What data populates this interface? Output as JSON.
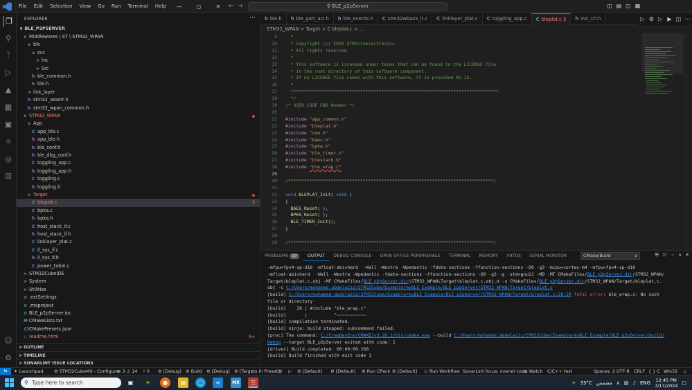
{
  "titlebar": {
    "menu": [
      "File",
      "Edit",
      "Selection",
      "View",
      "Go",
      "Run",
      "Terminal",
      "Help"
    ],
    "search": "BLE_p2pServer"
  },
  "sidebar": {
    "header": "EXPLORER",
    "project": "BLE_P2PSERVER",
    "tree": [
      {
        "depth": 1,
        "chev": "v",
        "label": "Middlewares \\ ST \\ STM32_WPAN",
        "type": "folder"
      },
      {
        "depth": 2,
        "chev": "v",
        "label": "ble",
        "type": "folder"
      },
      {
        "depth": 3,
        "chev": "v",
        "label": "svc",
        "type": "folder"
      },
      {
        "depth": 4,
        "chev": ">",
        "label": "Inc",
        "type": "folder"
      },
      {
        "depth": 4,
        "chev": ">",
        "label": "Src",
        "type": "folder"
      },
      {
        "depth": 3,
        "label": "ble_common.h",
        "type": "h"
      },
      {
        "depth": 3,
        "label": "ble.h",
        "type": "h"
      },
      {
        "depth": 2,
        "chev": ">",
        "label": "link_layer",
        "type": "folder"
      },
      {
        "depth": 2,
        "label": "stm32_assert.h",
        "type": "h"
      },
      {
        "depth": 2,
        "label": "stm32_wpan_common.h",
        "type": "h"
      },
      {
        "depth": 1,
        "chev": "v",
        "label": "STM32_WPAN",
        "type": "folder",
        "red": true,
        "dot": true
      },
      {
        "depth": 2,
        "chev": "v",
        "label": "App",
        "type": "folder"
      },
      {
        "depth": 3,
        "label": "app_ble.c",
        "type": "c"
      },
      {
        "depth": 3,
        "label": "app_ble.h",
        "type": "h"
      },
      {
        "depth": 3,
        "label": "ble_conf.h",
        "type": "h"
      },
      {
        "depth": 3,
        "label": "ble_dbg_conf.h",
        "type": "h"
      },
      {
        "depth": 3,
        "label": "toggling_app.c",
        "type": "c"
      },
      {
        "depth": 3,
        "label": "toggling_app.h",
        "type": "h"
      },
      {
        "depth": 3,
        "label": "toggling.c",
        "type": "c"
      },
      {
        "depth": 3,
        "label": "toggling.h",
        "type": "h"
      },
      {
        "depth": 2,
        "chev": "v",
        "label": "Target",
        "type": "folder",
        "red": true,
        "dot": true
      },
      {
        "depth": 3,
        "label": "bleplat.c",
        "type": "c",
        "red": true,
        "badge": "3",
        "selected": true
      },
      {
        "depth": 3,
        "label": "bpka.c",
        "type": "c"
      },
      {
        "depth": 3,
        "label": "bpka.h",
        "type": "h"
      },
      {
        "depth": 3,
        "label": "host_stack_if.c",
        "type": "c"
      },
      {
        "depth": 3,
        "label": "host_stack_if.h",
        "type": "h"
      },
      {
        "depth": 3,
        "label": "linklayer_plat.c",
        "type": "c"
      },
      {
        "depth": 3,
        "label": "ll_sys_if.c",
        "type": "c"
      },
      {
        "depth": 3,
        "label": "ll_sys_if.h",
        "type": "h"
      },
      {
        "depth": 3,
        "label": "power_table.c",
        "type": "c"
      },
      {
        "depth": 1,
        "chev": ">",
        "label": "STM32CubeIDE",
        "type": "folder"
      },
      {
        "depth": 1,
        "chev": ">",
        "label": "System",
        "type": "folder"
      },
      {
        "depth": 1,
        "chev": ">",
        "label": "Utilities",
        "type": "folder"
      },
      {
        "depth": 1,
        "label": ".extSettings",
        "type": "cfg"
      },
      {
        "depth": 1,
        "label": ".mxproject",
        "type": "cfg"
      },
      {
        "depth": 1,
        "label": "BLE_p2pServer.ioc",
        "type": "ioc"
      },
      {
        "depth": 1,
        "label": "CMakeLists.txt",
        "type": "cm"
      },
      {
        "depth": 1,
        "label": "CMakePresets.json",
        "type": "json"
      },
      {
        "depth": 1,
        "label": "readme.html",
        "type": "html",
        "red": true,
        "badge": "9+"
      }
    ],
    "sections": [
      "OUTLINE",
      "TIMELINE",
      "SONARLINT ISSUE LOCATIONS"
    ]
  },
  "tabs": [
    {
      "label": "ble.h",
      "icon": "h"
    },
    {
      "label": "ble_gatt_aci.h",
      "icon": "h"
    },
    {
      "label": "ble_events.h",
      "icon": "h"
    },
    {
      "label": "stm32wbaxx_it.c",
      "icon": "c"
    },
    {
      "label": "linklayer_plat.c",
      "icon": "c"
    },
    {
      "label": "toggling_app.c",
      "icon": "c"
    },
    {
      "label": "bleplat.c 3",
      "icon": "c",
      "active": true
    },
    {
      "label": "svc_ctl.h",
      "icon": "h"
    }
  ],
  "breadcrumb": "STM32_WPAN  >  Target  >  C  bleplat.c  >  ...",
  "editor": {
    "lines": [
      {
        "n": "9",
        "segs": [
          [
            "c-com",
            "  *"
          ]
        ]
      },
      {
        "n": "10",
        "segs": [
          [
            "c-com",
            "  * Copyright (c) 2024 STMicroelectronics."
          ]
        ]
      },
      {
        "n": "11",
        "segs": [
          [
            "c-com",
            "  * All rights reserved."
          ]
        ]
      },
      {
        "n": "12",
        "segs": [
          [
            "c-com",
            "  *"
          ]
        ]
      },
      {
        "n": "13",
        "segs": [
          [
            "c-com",
            "  * This software is licensed under terms that can be found in the LICENSE file"
          ]
        ]
      },
      {
        "n": "14",
        "segs": [
          [
            "c-com",
            "  * in the root directory of this software component."
          ]
        ]
      },
      {
        "n": "15",
        "segs": [
          [
            "c-com",
            "  * If no LICENSE file comes with this software, it is provided AS-IS."
          ]
        ]
      },
      {
        "n": "16",
        "segs": [
          [
            "c-com",
            "  *"
          ]
        ]
      },
      {
        "n": "17",
        "segs": [
          [
            "c-com",
            "  ******************************************************************************"
          ]
        ]
      },
      {
        "n": "18",
        "segs": [
          [
            "c-com",
            "  */"
          ]
        ]
      },
      {
        "n": "19",
        "segs": [
          [
            "c-com",
            "/* USER CODE END Header */"
          ]
        ]
      },
      {
        "n": "20",
        "segs": []
      },
      {
        "n": "21",
        "segs": [
          [
            "c-kw",
            "#include "
          ],
          [
            "c-str",
            "\"app_common.h\""
          ]
        ]
      },
      {
        "n": "22",
        "segs": [
          [
            "c-kw",
            "#include "
          ],
          [
            "c-str",
            "\"bleplat.h\""
          ]
        ]
      },
      {
        "n": "23",
        "segs": [
          [
            "c-kw",
            "#include "
          ],
          [
            "c-str",
            "\"nvm.h\""
          ]
        ]
      },
      {
        "n": "24",
        "segs": [
          [
            "c-kw",
            "#include "
          ],
          [
            "c-str",
            "\"baes.h\""
          ]
        ]
      },
      {
        "n": "25",
        "segs": [
          [
            "c-kw",
            "#include "
          ],
          [
            "c-str",
            "\"bpka.h\""
          ]
        ]
      },
      {
        "n": "26",
        "segs": [
          [
            "c-kw",
            "#include "
          ],
          [
            "c-str",
            "\"ble_timer.h\""
          ]
        ]
      },
      {
        "n": "27",
        "segs": [
          [
            "c-kw",
            "#include "
          ],
          [
            "c-str",
            "\"blestack.h\""
          ]
        ]
      },
      {
        "n": "28",
        "segs": [
          [
            "c-kw",
            "#include "
          ],
          [
            "c-str squig",
            "\"ble_wrap.c\""
          ]
        ]
      },
      {
        "n": "29",
        "segs": [],
        "cur": true
      },
      {
        "n": "30",
        "segs": [
          [
            "c-com",
            "/*****************************************************************************/"
          ]
        ]
      },
      {
        "n": "31",
        "segs": []
      },
      {
        "n": "32",
        "segs": [
          [
            "c-ty",
            "void "
          ],
          [
            "c-fn",
            "BLEPLAT_Init"
          ],
          [
            "",
            "( "
          ],
          [
            "c-ty",
            "void"
          ],
          [
            "",
            " )"
          ]
        ]
      },
      {
        "n": "33",
        "segs": [
          [
            "",
            "{"
          ]
        ]
      },
      {
        "n": "34",
        "segs": [
          [
            "",
            "  "
          ],
          [
            "c-fn",
            "BAES_Reset"
          ],
          [
            "",
            "( );"
          ]
        ]
      },
      {
        "n": "35",
        "segs": [
          [
            "",
            "  "
          ],
          [
            "c-fn",
            "BPKA_Reset"
          ],
          [
            "",
            "( );"
          ]
        ]
      },
      {
        "n": "36",
        "segs": [
          [
            "",
            "  "
          ],
          [
            "c-fn",
            "BLE_TIMER_Init"
          ],
          [
            "",
            "();"
          ]
        ]
      },
      {
        "n": "37",
        "segs": [
          [
            "",
            "}"
          ]
        ]
      },
      {
        "n": "38",
        "segs": []
      },
      {
        "n": "39",
        "segs": [
          [
            "c-com",
            "/*****************************************************************************/"
          ]
        ]
      }
    ]
  },
  "panel": {
    "tabs": [
      {
        "label": "PROBLEMS",
        "count": "17"
      },
      {
        "label": "OUTPUT",
        "active": true
      },
      {
        "label": "DEBUG CONSOLE"
      },
      {
        "label": "OPEN OFFICE PERIPHERALS"
      },
      {
        "label": "TERMINAL"
      },
      {
        "label": "MEMORY"
      },
      {
        "label": "XRTOS"
      },
      {
        "label": "SERIAL MONITOR"
      }
    ],
    "channel": "CMake/Build",
    "output": [
      [
        [
          "",
          "-mfpu=fpv4-sp-d16 -mfloat-abi=hard  -Wall -Wextra -Wpedantic -fdata-sections -ffunction-sections -O0 -g3 -mcpu=cortex-m4 -mfpu=fpv4-sp-d16"
        ]
      ],
      [
        [
          "",
          "-mfloat-abi=hard  -Wall -Wextra -Wpedantic -fdata-sections -ffunction-sections -O0 -g3 -g -std=gnu11 -MD -MT CMakeFiles/"
        ],
        [
          "olink",
          "BLE_p2pServer.dir"
        ],
        [
          "",
          "/STM32_WPAN/"
        ]
      ],
      [
        [
          "",
          "Target/bleplat.c.obj -MF CMakeFiles/"
        ],
        [
          "olink",
          "BLE_p2pServer.dir"
        ],
        [
          "",
          "\\STM32_WPAN\\Target\\bleplat.c.obj.d -o CMakeFiles/"
        ],
        [
          "olink",
          "BLE_p2pServer.dir"
        ],
        [
          "",
          "/STM32_WPAN/Target/bleplat.c."
        ]
      ],
      [
        [
          "",
          "obj -c "
        ],
        [
          "olink",
          "C:/Users/mohamed.abdelaziz/STM32Cube/Example/myBLE_Example/BLE_p2pServer/STM32_WPAN/Target/bleplat.c"
        ]
      ],
      [
        [
          "",
          "[build] "
        ],
        [
          "olink",
          "C:/Users/mohamed.abdelaziz/STM32Cube/Example/myBLE_Example/BLE_p2pServer/STM32_WPAN/Target/bleplat.c:28:10"
        ],
        [
          ":",
          " "
        ],
        [
          "oerr",
          "fatal error"
        ],
        [
          "",
          ": ble_wrap.c: No such"
        ]
      ],
      [
        [
          "",
          "file or directory"
        ]
      ],
      [
        [
          "",
          "[build]    28 | #include \"ble_wrap.c\""
        ]
      ],
      [
        [
          "",
          "[build]       |          ^~~~~~~~~~~~"
        ]
      ],
      [
        [
          "",
          "[build] compilation terminated."
        ]
      ],
      [
        [
          "",
          "[build] ninja: build stopped: subcommand failed."
        ]
      ],
      [
        [
          "",
          "[proc] The command: "
        ],
        [
          "olink",
          "C:/CrewDevEnv/CMAKE/v3.26.2/bin/cmake.exe"
        ],
        [
          "",
          " --build "
        ],
        [
          "olink",
          "C:/Users/mohamed.abdelaziz/STM32Cube/Example/myBLE_Example/BLE_p2pServer/build/"
        ]
      ],
      [
        [
          "olink",
          "Debug"
        ],
        [
          "",
          " --target BLE_p2pServer exited with code: 1"
        ]
      ],
      [
        [
          "",
          "[driver] Build completed: 00:00:00.268"
        ]
      ],
      [
        [
          "",
          "[build] Build finished with exit code 1"
        ]
      ]
    ]
  },
  "status": {
    "launchpad": "Launchpad",
    "configure": "STM32CubeMX - Configure",
    "problems": "⊗ 3 ⚠ 14",
    "ports": "⑂ 0",
    "debug1": "[Debug]",
    "build": "Build",
    "debug2": "[Debug]",
    "targets": "[Targets In Preset]",
    "default1": "[Default]",
    "default2": "[Default]",
    "runcpack": "Run CPack",
    "default3": "[Default]",
    "workflow": "Run Workflow",
    "sonar": "SonarLint focus: overall code",
    "watch": "Watch",
    "lang_test": "C/C++ test",
    "spaces": "Spaces: 2",
    "encoding": "UTF-8",
    "eol": "CRLF",
    "lang": "{ } C",
    "platform": "Win32"
  },
  "taskbar": {
    "search": "Type here to search",
    "weather": "33°C",
    "weather_label": "مشمس",
    "lang": "ENG",
    "time": "12:45 PM",
    "date": "7/17/2024"
  }
}
